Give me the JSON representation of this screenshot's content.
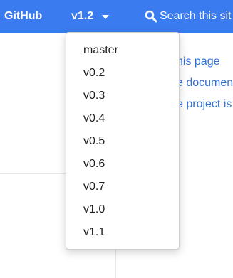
{
  "navbar": {
    "github_label": "GitHub",
    "version_label": "v1.2",
    "search_label": "Search this sit",
    "accent": "#3a7bef"
  },
  "side_links": [
    "his page",
    "e documen",
    "e project is"
  ],
  "version_menu": {
    "items": [
      "master",
      "v0.2",
      "v0.3",
      "v0.4",
      "v0.5",
      "v0.6",
      "v0.7",
      "v1.0",
      "v1.1"
    ]
  },
  "icons": {
    "search": "search-icon",
    "caret": "caret-down-icon"
  }
}
